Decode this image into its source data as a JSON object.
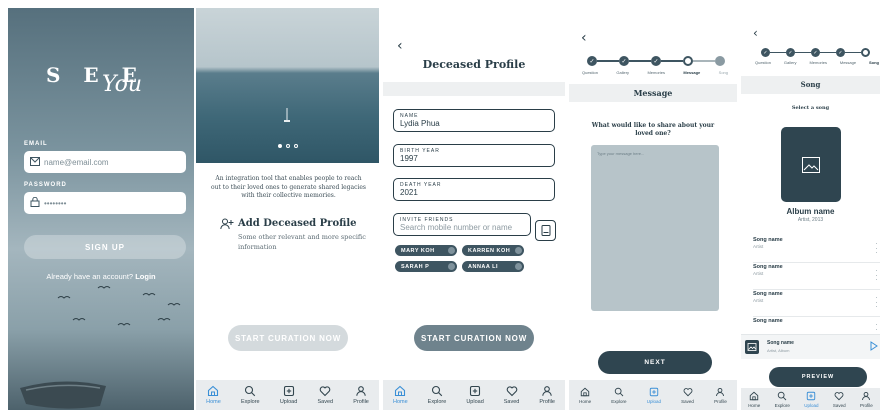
{
  "login": {
    "logo_text": "S E E",
    "logo_script": "You",
    "email_label": "EMAIL",
    "email_placeholder": "name@email.com",
    "password_label": "PASSWORD",
    "password_value": "••••••••",
    "signup_label": "SIGN UP",
    "account_text": "Already have an account?",
    "login_link": "Login"
  },
  "onboarding": {
    "intro_text": "An integration tool that enables people to reach out to their loved ones to generate shared legacies with their collective memories.",
    "feature_title": "Add Deceased Profile",
    "feature_desc": "Some other relevant and more specific information",
    "cta_label": "START CURATION NOW",
    "carousel_dots": 3,
    "carousel_active": 1
  },
  "profile": {
    "title": "Deceased Profile",
    "name_label": "NAME",
    "name_value": "Lydia Phua",
    "birth_label": "BIRTH YEAR",
    "birth_value": "1997",
    "death_label": "DEATH YEAR",
    "death_value": "2021",
    "invite_label": "INVITE FRIENDS",
    "invite_placeholder": "Search mobile number or name",
    "chips": [
      "MARY KOH",
      "KARREN KOH",
      "SARAH P",
      "ANNAA LI"
    ],
    "cta_label": "START CURATION NOW"
  },
  "message": {
    "steps": [
      "Question",
      "Gallery",
      "Memories",
      "Message",
      "Song"
    ],
    "title": "Message",
    "question": "What would like to share about your loved one?",
    "placeholder": "Type your message here...",
    "next_label": "NEXT"
  },
  "song": {
    "steps": [
      "Question",
      "Gallery",
      "Memories",
      "Message",
      "Song"
    ],
    "title": "Song",
    "select_label": "Select a song",
    "album_name": "Album name",
    "album_sub": "Artist, 2013",
    "songs": [
      {
        "name": "Song name",
        "artist": "Artist"
      },
      {
        "name": "Song name",
        "artist": "Artist"
      },
      {
        "name": "Song name",
        "artist": "Artist"
      },
      {
        "name": "Song name",
        "artist": ""
      }
    ],
    "player_name": "Song name",
    "player_sub": "Artist, Album",
    "preview_label": "PREVIEW"
  },
  "nav": {
    "items": [
      "Home",
      "Explore",
      "Upload",
      "Saved",
      "Profile"
    ]
  },
  "colors": {
    "primary": "#2f4550",
    "active_nav": "#3a8fd6",
    "chip": "#3e5561",
    "message_box": "#b7c4c9"
  }
}
